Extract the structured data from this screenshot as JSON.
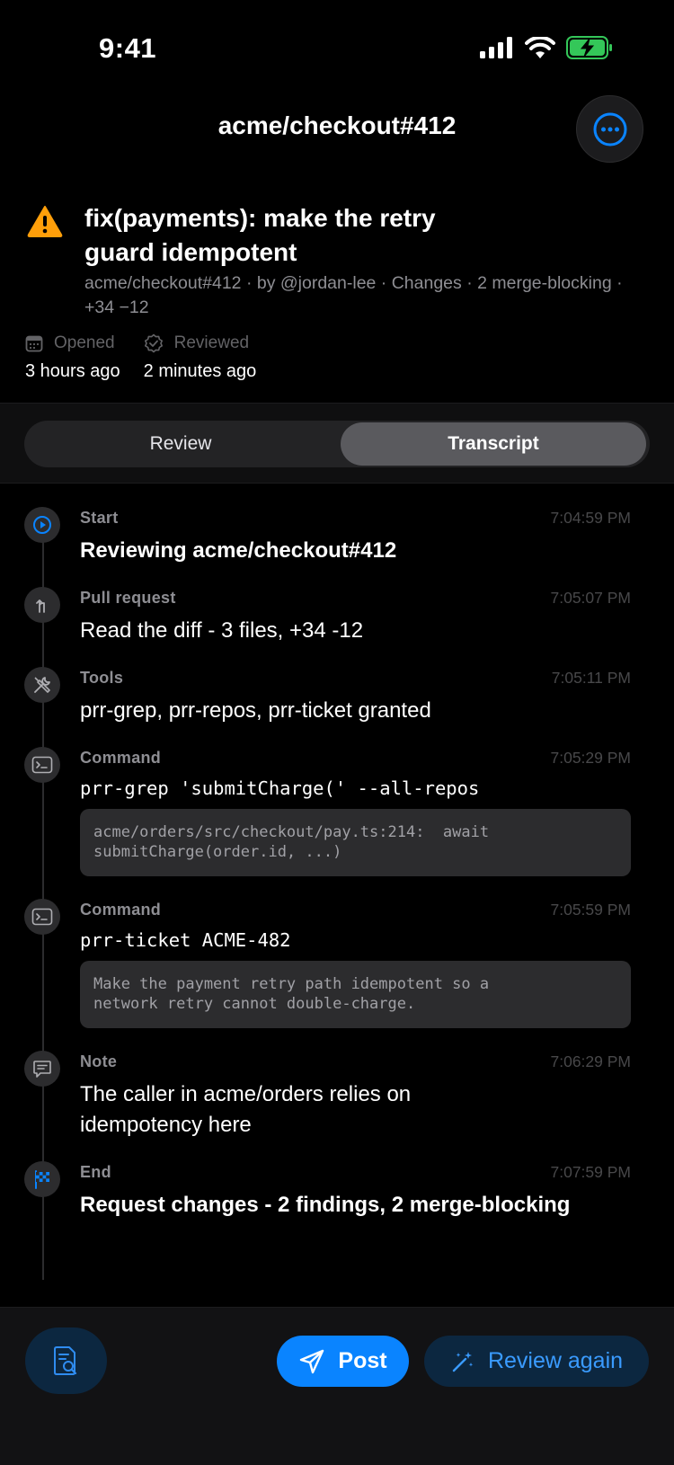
{
  "status_bar": {
    "time": "9:41"
  },
  "nav": {
    "title": "acme/checkout#412",
    "more_icon": "ellipsis-circle-icon"
  },
  "pr": {
    "title": "fix(payments): make the retry guard idempotent",
    "meta": "acme/checkout#412 · by @jordan-lee · Changes · 2 merge-blocking · +34 −12",
    "opened_label": "Opened",
    "opened_value": "3 hours ago",
    "reviewed_label": "Reviewed",
    "reviewed_value": "2 minutes ago"
  },
  "tabs": [
    {
      "label": "Review",
      "selected": false
    },
    {
      "label": "Transcript",
      "selected": true
    }
  ],
  "events": [
    {
      "type": "Start",
      "time": "7:04:59 PM",
      "text": "Reviewing acme/checkout#412",
      "icon": "play-icon"
    },
    {
      "type": "Pull request",
      "time": "7:05:07 PM",
      "text": "Read the diff - 3 files, +34 -12",
      "icon": "pull-request-icon"
    },
    {
      "type": "Tools",
      "time": "7:05:11 PM",
      "text": "prr-grep, prr-repos, prr-ticket granted",
      "icon": "tools-icon"
    },
    {
      "type": "Command",
      "time": "7:05:29 PM",
      "command": "prr-grep 'submitCharge(' --all-repos",
      "output": "acme/orders/src/checkout/pay.ts:214:  await\nsubmitCharge(order.id, ...)",
      "icon": "terminal-icon"
    },
    {
      "type": "Command",
      "time": "7:05:59 PM",
      "command": "prr-ticket ACME-482",
      "output": "Make the payment retry path idempotent so a\nnetwork retry cannot double-charge.",
      "icon": "terminal-icon"
    },
    {
      "type": "Note",
      "time": "7:06:29 PM",
      "text": "The caller in acme/orders relies on idempotency here",
      "icon": "note-icon"
    },
    {
      "type": "End",
      "time": "7:07:59 PM",
      "text": "Request changes - 2 findings, 2 merge-blocking",
      "icon": "checkered-flag-icon"
    }
  ],
  "bottom_bar": {
    "post_label": "Post",
    "review_again_label": "Review again"
  },
  "colors": {
    "accent": "#0a84ff",
    "warning": "#ff9f0a",
    "battery": "#34c759"
  }
}
